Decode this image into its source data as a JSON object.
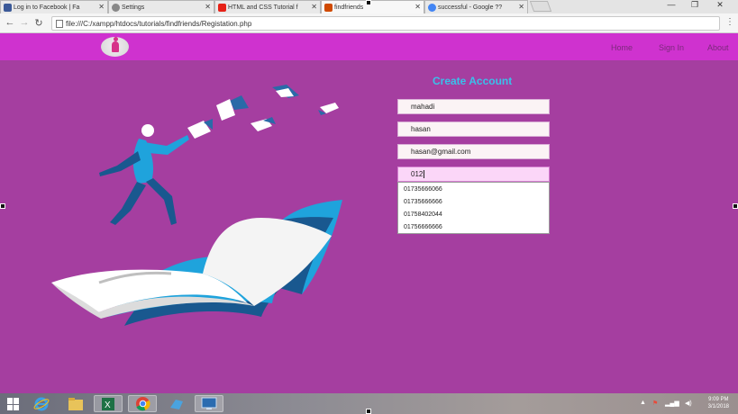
{
  "browser": {
    "tabs": [
      {
        "title": "Log in to Facebook | Fa",
        "favicon_color": "#3b5998"
      },
      {
        "title": "Settings",
        "favicon_color": "#777777"
      },
      {
        "title": "HTML and CSS Tutorial f",
        "favicon_color": "#e62117"
      },
      {
        "title": "findfriends",
        "favicon_color": "#d04a02"
      },
      {
        "title": "successful - Google ??",
        "favicon_color": "#4285f4"
      }
    ],
    "active_tab_index": 3,
    "url": "file:///C:/xampp/htdocs/tutorials/findfriends/Registation.php",
    "window_controls": [
      "—",
      "❐",
      "✕"
    ],
    "menu_icon": "⋮"
  },
  "site": {
    "nav": {
      "home": "Home",
      "signin": "Sign In",
      "about": "About"
    },
    "form": {
      "title": "Create Account",
      "first_name": "mahadi",
      "last_name": "hasan",
      "email": "hasan@gmail.com",
      "phone": "012"
    },
    "suggestions": [
      "01735666066",
      "01735666666",
      "01758402044",
      "01756666666"
    ],
    "colors": {
      "background": "#a53ea0",
      "navbar": "#cf32cf",
      "title": "#3ac0ea"
    }
  },
  "taskbar": {
    "apps": [
      "internet-explorer-icon",
      "file-explorer-icon",
      "excel-icon",
      "chrome-icon",
      "app-icon",
      "screen-icon"
    ],
    "clock": {
      "time": "9:09 PM",
      "date": "3/1/2018"
    }
  }
}
